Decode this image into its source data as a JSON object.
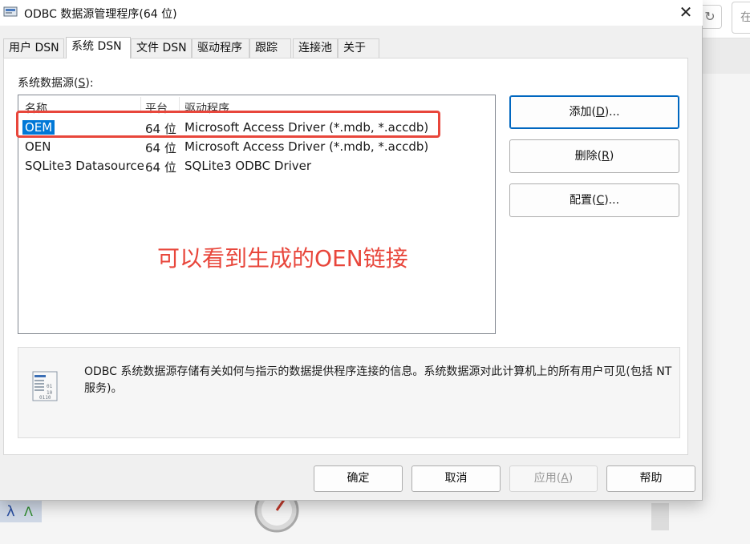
{
  "background": {
    "search_placeholder": "在",
    "refresh_glyph": "↻"
  },
  "window": {
    "title": "ODBC 数据源管理程序(64 位)",
    "close_glyph": "✕"
  },
  "tabs": [
    {
      "label": "用户 DSN"
    },
    {
      "label": "系统 DSN",
      "active": true
    },
    {
      "label": "文件 DSN"
    },
    {
      "label": "驱动程序"
    },
    {
      "label": "跟踪"
    },
    {
      "label": "连接池"
    },
    {
      "label": "关于"
    }
  ],
  "system_ds": {
    "label_prefix": "系统数据源(",
    "label_key": "S",
    "label_suffix": "):",
    "columns": [
      "名称",
      "平台",
      "驱动程序"
    ],
    "rows": [
      {
        "name": "OEM",
        "platform": "64 位",
        "driver": "Microsoft Access Driver (*.mdb, *.accdb)",
        "selected": true
      },
      {
        "name": "OEN",
        "platform": "64 位",
        "driver": "Microsoft Access Driver (*.mdb, *.accdb)"
      },
      {
        "name": "SQLite3 Datasource",
        "platform": "64 位",
        "driver": "SQLite3 ODBC Driver"
      }
    ]
  },
  "annotation": "可以看到生成的OEN链接",
  "side_buttons": {
    "add": {
      "pre": "添加(",
      "key": "D",
      "post": ")..."
    },
    "remove": {
      "pre": "删除(",
      "key": "R",
      "post": ")"
    },
    "configure": {
      "pre": "配置(",
      "key": "C",
      "post": ")..."
    }
  },
  "info_text": "ODBC 系统数据源存储有关如何与指示的数据提供程序连接的信息。系统数据源对此计算机上的所有用户可见(包括 NT 服务)。",
  "footer_buttons": {
    "ok": "确定",
    "cancel": "取消",
    "apply": {
      "pre": "应用(",
      "key": "A",
      "post": ")"
    },
    "help": "帮助"
  },
  "colors": {
    "selection": "#0078d7",
    "annotation": "#e8463b",
    "accent_border": "#0067c0"
  }
}
